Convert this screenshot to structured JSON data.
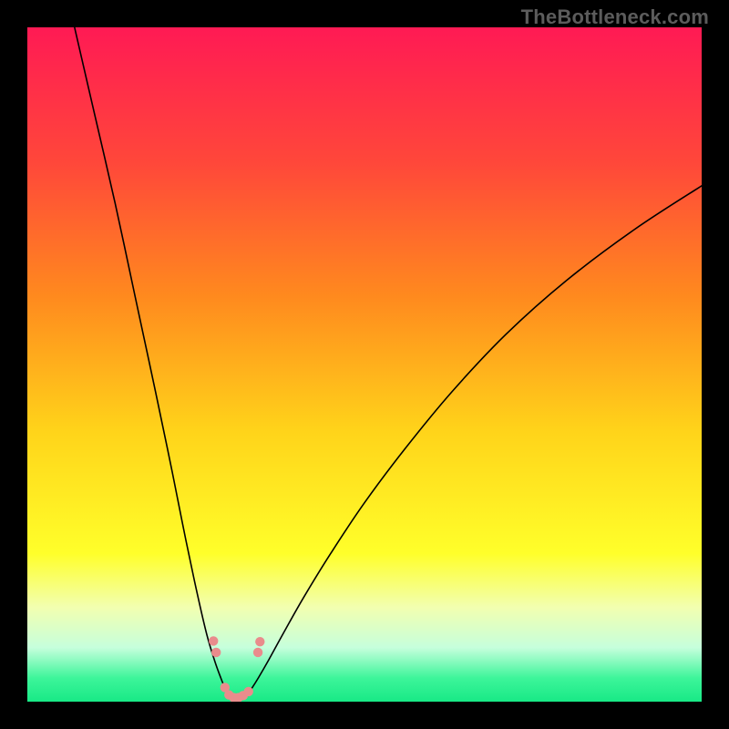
{
  "watermark": "TheBottleneck.com",
  "chart_data": {
    "type": "line",
    "title": "",
    "xlabel": "",
    "ylabel": "",
    "xlim": [
      0,
      100
    ],
    "ylim": [
      0,
      100
    ],
    "grid": false,
    "gradient_stops": [
      {
        "offset": 0.0,
        "color": "#ff1a54"
      },
      {
        "offset": 0.2,
        "color": "#ff473a"
      },
      {
        "offset": 0.4,
        "color": "#ff8a1e"
      },
      {
        "offset": 0.6,
        "color": "#ffd41a"
      },
      {
        "offset": 0.78,
        "color": "#ffff2a"
      },
      {
        "offset": 0.86,
        "color": "#f2ffb0"
      },
      {
        "offset": 0.92,
        "color": "#c6ffdc"
      },
      {
        "offset": 0.965,
        "color": "#3df59a"
      },
      {
        "offset": 1.0,
        "color": "#18e986"
      }
    ],
    "series": [
      {
        "name": "left-curve",
        "color": "#000000",
        "width": 1.6,
        "x": [
          7.0,
          10.0,
          13.0,
          16.0,
          19.0,
          21.5,
          23.5,
          25.2,
          26.6,
          27.8,
          28.7,
          29.3,
          29.7
        ],
        "y": [
          100.0,
          87.0,
          74.0,
          60.0,
          46.0,
          34.0,
          24.0,
          16.0,
          10.0,
          6.0,
          3.5,
          2.0,
          1.0
        ]
      },
      {
        "name": "right-curve",
        "color": "#000000",
        "width": 1.6,
        "x": [
          32.6,
          33.3,
          34.3,
          35.8,
          38.0,
          41.0,
          45.0,
          50.0,
          56.0,
          63.0,
          71.0,
          80.0,
          90.0,
          100.0
        ],
        "y": [
          1.0,
          2.0,
          3.6,
          6.2,
          10.2,
          15.5,
          22.0,
          29.5,
          37.5,
          46.0,
          54.5,
          62.5,
          70.0,
          76.5
        ]
      },
      {
        "name": "valley-floor",
        "color": "#000000",
        "width": 1.6,
        "x": [
          29.7,
          30.2,
          31.0,
          31.8,
          32.6
        ],
        "y": [
          1.0,
          0.6,
          0.5,
          0.6,
          1.0
        ]
      }
    ],
    "markers": {
      "color": "#e98c8c",
      "radius": 5.2,
      "points": [
        {
          "x": 27.6,
          "y": 9.0
        },
        {
          "x": 28.0,
          "y": 7.3
        },
        {
          "x": 29.3,
          "y": 2.1
        },
        {
          "x": 29.9,
          "y": 1.0
        },
        {
          "x": 30.6,
          "y": 0.6
        },
        {
          "x": 31.3,
          "y": 0.6
        },
        {
          "x": 32.0,
          "y": 0.9
        },
        {
          "x": 32.8,
          "y": 1.5
        },
        {
          "x": 34.2,
          "y": 7.3
        },
        {
          "x": 34.5,
          "y": 8.9
        }
      ]
    }
  }
}
